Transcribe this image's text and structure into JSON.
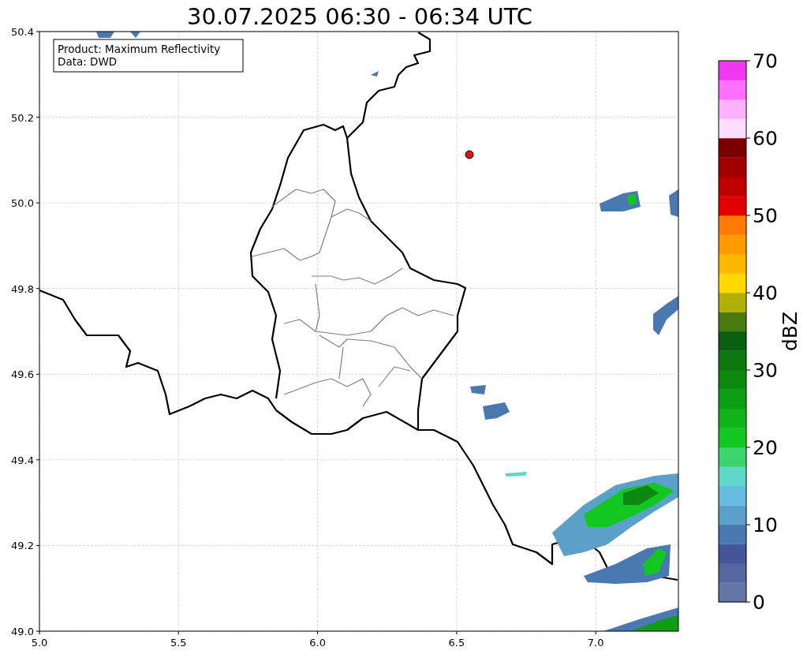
{
  "title": "30.07.2025 06:30 - 06:34 UTC",
  "legend": {
    "lines": [
      "Product: Maximum Reflectivity",
      "Data: DWD"
    ]
  },
  "x_axis": {
    "ticks": [
      "5.0",
      "5.5",
      "6.0",
      "6.5",
      "7.0"
    ]
  },
  "y_axis": {
    "ticks": [
      "50.4",
      "50.2",
      "50.0",
      "49.8",
      "49.6",
      "49.4",
      "49.2",
      "49.0"
    ]
  },
  "colorbar": {
    "label": "dBZ",
    "ticks": [
      "70",
      "60",
      "50",
      "40",
      "30",
      "20",
      "10",
      "0"
    ],
    "bins": [
      {
        "color": "#6576a6"
      },
      {
        "color": "#55679f"
      },
      {
        "color": "#43569a"
      },
      {
        "color": "#4a78b0"
      },
      {
        "color": "#5aa0c8"
      },
      {
        "color": "#64bde0"
      },
      {
        "color": "#60d6c8"
      },
      {
        "color": "#3cd46e"
      },
      {
        "color": "#12c820"
      },
      {
        "color": "#0fb41a"
      },
      {
        "color": "#0e9e14"
      },
      {
        "color": "#0c8a10"
      },
      {
        "color": "#0b7810"
      },
      {
        "color": "#0a5e10"
      },
      {
        "color": "#4a7a10"
      },
      {
        "color": "#b0b008"
      },
      {
        "color": "#ffd800"
      },
      {
        "color": "#ffb800"
      },
      {
        "color": "#ff9a00"
      },
      {
        "color": "#ff7a00"
      },
      {
        "color": "#e00000"
      },
      {
        "color": "#c00000"
      },
      {
        "color": "#a00000"
      },
      {
        "color": "#7a0000"
      },
      {
        "color": "#ffddff"
      },
      {
        "color": "#ffb0ff"
      },
      {
        "color": "#ff70ff"
      },
      {
        "color": "#f038f0"
      }
    ]
  }
}
